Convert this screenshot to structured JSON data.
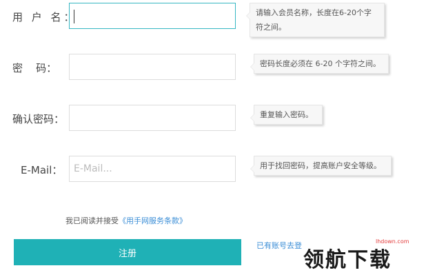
{
  "fields": [
    {
      "label": "用 户 名：",
      "value": "",
      "placeholder": "",
      "tip_line1": "请输入会员名称，长度在6-20个字",
      "tip_line2": "符之间。"
    },
    {
      "label": "密    码：",
      "value": "",
      "placeholder": "",
      "tip_line1": "密码长度必须在 6-20 个字符之间。"
    },
    {
      "label": "确认密码：",
      "value": "",
      "placeholder": "",
      "tip_line1": "重复输入密码。"
    },
    {
      "label": "E-Mail：",
      "value": "",
      "placeholder": "E-Mail...",
      "tip_line1": "用于找回密码，提高账户安全等级。"
    }
  ],
  "agreement": {
    "prefix": "我已阅读并接受",
    "link": "《用手网服务条款》"
  },
  "register_button": "注册",
  "login_link": "已有账号去登",
  "watermark": {
    "text": "领航下载",
    "url": "lhdown.com"
  },
  "colors": {
    "accent": "#1fb1b6",
    "link": "#3a8dd6",
    "active_border": "#34b6c2"
  }
}
